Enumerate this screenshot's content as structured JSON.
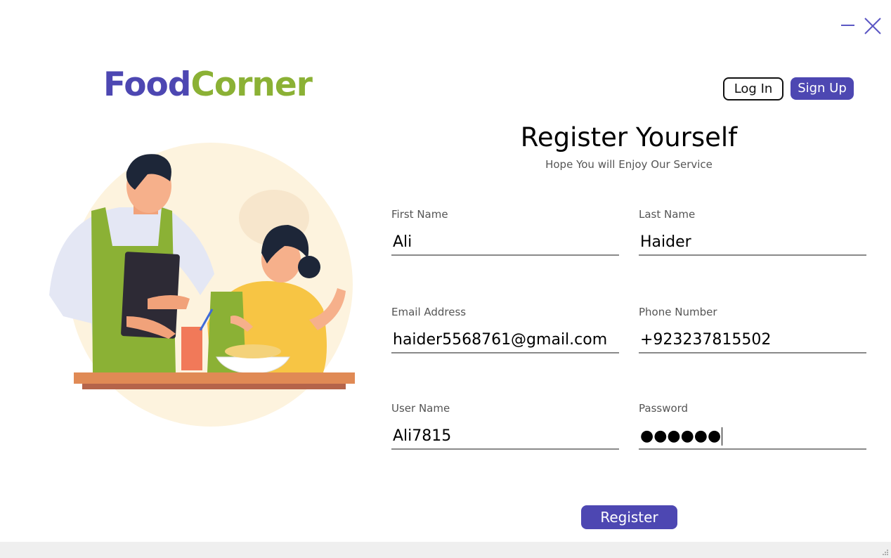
{
  "window": {
    "minimize_icon": "minimize-icon",
    "close_icon": "close-icon"
  },
  "logo": {
    "part1": "Food",
    "part2": "Corner",
    "colors": {
      "part1": "#4d47b2",
      "part2": "#8bb135"
    }
  },
  "header": {
    "login_label": "Log In",
    "signup_label": "Sign Up"
  },
  "form": {
    "title": "Register Yourself",
    "subtitle": "Hope You will Enjoy Our Service",
    "first_name": {
      "label": "First Name",
      "value": "Ali"
    },
    "last_name": {
      "label": "Last Name",
      "value": "Haider"
    },
    "email": {
      "label": "Email Address",
      "value": "haider5568761@gmail.com"
    },
    "phone": {
      "label": "Phone Number",
      "value": "+923237815502"
    },
    "username": {
      "label": "User Name",
      "value": "Ali7815"
    },
    "password": {
      "label": "Password",
      "value": "●●●●●●"
    },
    "register_label": "Register"
  },
  "accent_color": "#4d47b2"
}
